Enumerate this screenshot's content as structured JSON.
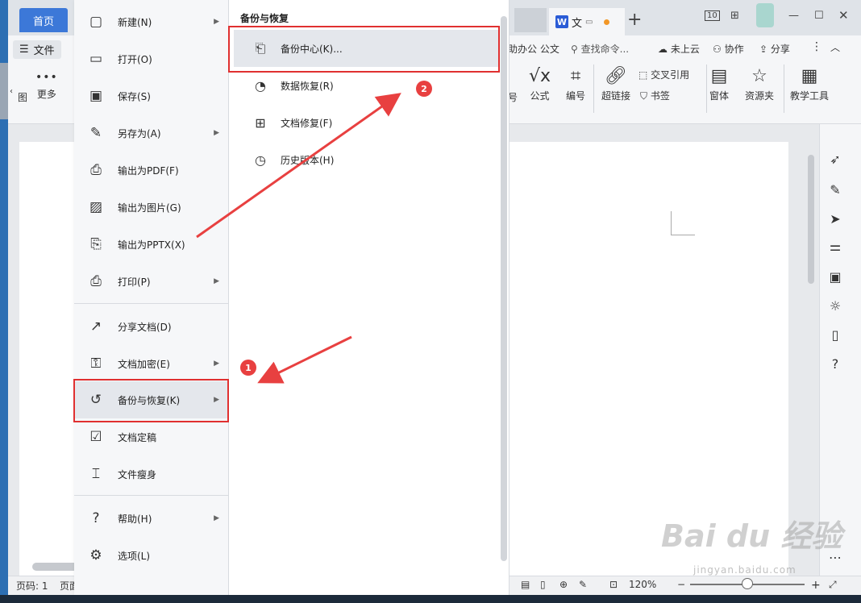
{
  "titlebar": {
    "home_tab": "首页",
    "doc_tab": "文",
    "doc_tab_icon": "W",
    "page_indicator": "10",
    "plus": "+"
  },
  "ribbon": {
    "file_menu": "文件",
    "more": "更多",
    "partial_left": "图",
    "toolbar_text": "助办公 公文",
    "search_placeholder": "查找命令...",
    "cloud": "未上云",
    "collab": "协作",
    "share": "分享",
    "formula": "公式",
    "numbering": "编号",
    "hyperlink": "超链接",
    "cross_ref": "交叉引用",
    "bookmark": "书签",
    "window": "窗体",
    "resource": "资源夹",
    "teach": "教学工具",
    "partial_left2": "号"
  },
  "file_menu": {
    "items": [
      {
        "label": "新建(N)",
        "icon": "new-doc-icon",
        "submenu": true
      },
      {
        "label": "打开(O)",
        "icon": "folder-icon",
        "submenu": false
      },
      {
        "label": "保存(S)",
        "icon": "save-icon",
        "submenu": false
      },
      {
        "label": "另存为(A)",
        "icon": "save-as-icon",
        "submenu": true
      },
      {
        "label": "输出为PDF(F)",
        "icon": "pdf-icon",
        "submenu": false
      },
      {
        "label": "输出为图片(G)",
        "icon": "image-icon",
        "submenu": false
      },
      {
        "label": "输出为PPTX(X)",
        "icon": "pptx-icon",
        "submenu": false
      },
      {
        "label": "打印(P)",
        "icon": "print-icon",
        "submenu": true
      },
      {
        "label": "分享文档(D)",
        "icon": "share-icon",
        "submenu": false
      },
      {
        "label": "文档加密(E)",
        "icon": "lock-doc-icon",
        "submenu": true
      },
      {
        "label": "备份与恢复(K)",
        "icon": "backup-icon",
        "submenu": true
      },
      {
        "label": "文档定稿",
        "icon": "finalize-icon",
        "submenu": false
      },
      {
        "label": "文件瘦身",
        "icon": "slim-icon",
        "submenu": false
      },
      {
        "label": "帮助(H)",
        "icon": "help-icon",
        "submenu": true
      },
      {
        "label": "选项(L)",
        "icon": "settings-icon",
        "submenu": false
      }
    ]
  },
  "submenu": {
    "title": "备份与恢复",
    "items": [
      {
        "label": "备份中心(K)...",
        "icon": "backup-center-icon"
      },
      {
        "label": "数据恢复(R)",
        "icon": "data-recovery-icon"
      },
      {
        "label": "文档修复(F)",
        "icon": "repair-icon"
      },
      {
        "label": "历史版本(H)",
        "icon": "history-icon"
      }
    ]
  },
  "annotations": {
    "badge1": "1",
    "badge2": "2"
  },
  "status": {
    "page": "页码: 1",
    "page2": "页面",
    "zoom": "120%"
  },
  "watermark": {
    "main": "Bai du 经验",
    "sub": "jingyan.baidu.com"
  },
  "colors": {
    "accent": "#3c78d8",
    "highlight_red": "#e03030"
  }
}
